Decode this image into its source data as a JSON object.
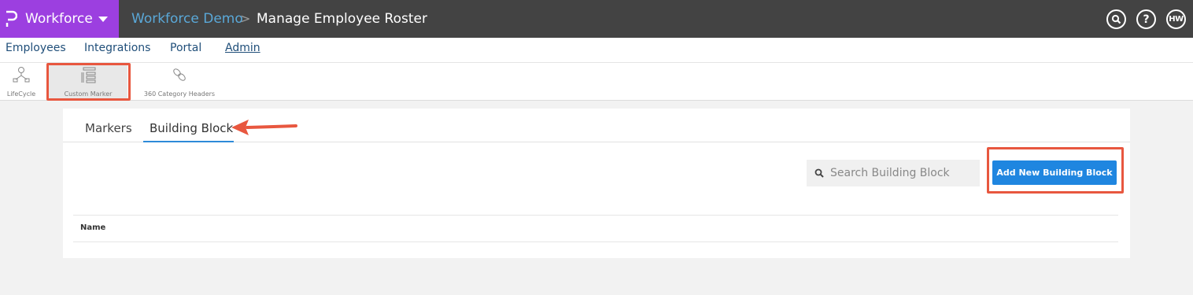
{
  "header": {
    "brand": "Workforce",
    "breadcrumb": [
      "Workforce Demo",
      "Manage Employee Roster"
    ],
    "breadcrumb_separator": ">",
    "user_initials": "HW",
    "help_glyph": "?",
    "colors": {
      "bar": "#434343",
      "brand": "#9c3fe0",
      "crumb_link": "#5aa8d8"
    }
  },
  "nav": {
    "items": [
      "Employees",
      "Integrations",
      "Portal",
      "Admin"
    ],
    "active": "Admin"
  },
  "toolbar": {
    "items": [
      {
        "label": "LifeCycle",
        "icon": "lifecycle-icon"
      },
      {
        "label": "Custom Marker",
        "icon": "custom-marker-icon",
        "selected": true
      },
      {
        "label": "360 Category Headers",
        "icon": "link-chain-icon"
      }
    ]
  },
  "main": {
    "tabs": [
      "Markers",
      "Building Block"
    ],
    "active_tab": "Building Block",
    "search": {
      "placeholder": "Search Building Block"
    },
    "add_button": "Add New Building Block",
    "table": {
      "columns": [
        "Name"
      ]
    }
  },
  "annotation_color": "#e8573f",
  "accent": "#1f86e0"
}
